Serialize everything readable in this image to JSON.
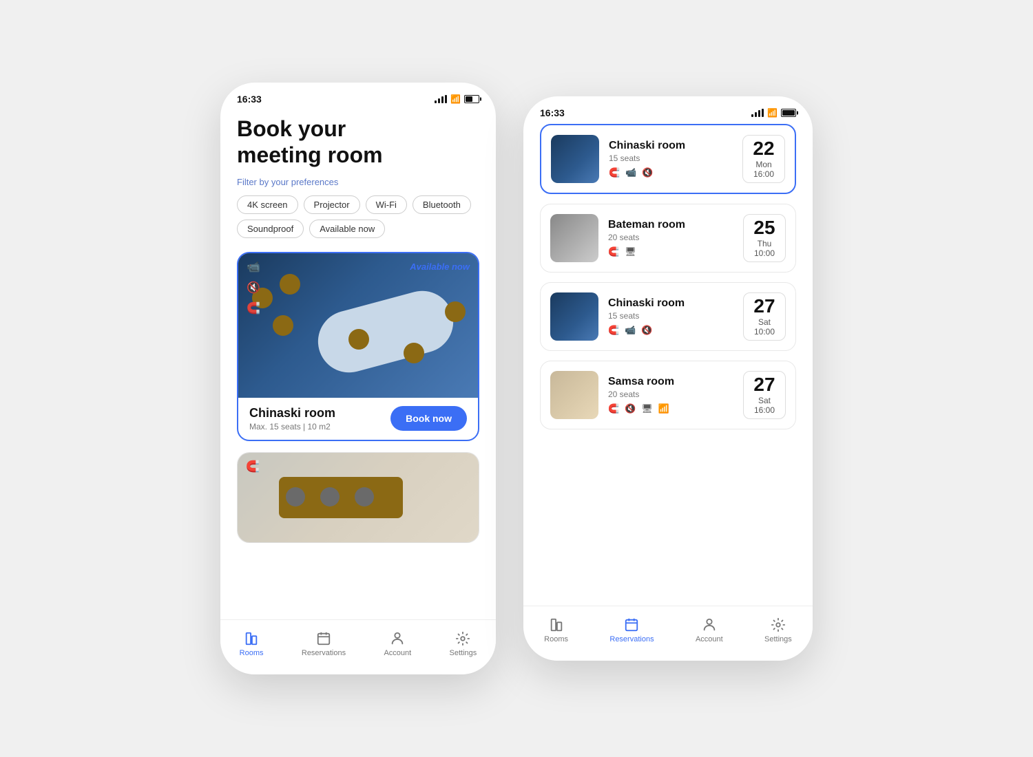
{
  "leftPhone": {
    "statusBar": {
      "time": "16:33"
    },
    "title": "Book your\nmeeting room",
    "filterLabel": "Filter by your preferences",
    "filters": [
      {
        "label": "4K screen",
        "active": false
      },
      {
        "label": "Projector",
        "active": false
      },
      {
        "label": "Wi-Fi",
        "active": false
      },
      {
        "label": "Bluetooth",
        "active": false
      },
      {
        "label": "Soundproof",
        "active": false
      },
      {
        "label": "Available now",
        "active": false
      }
    ],
    "featuredRoom": {
      "name": "Chinaski room",
      "seats": "Max. 15 seats",
      "size": "10 m2",
      "badge": "Available now",
      "bookLabel": "Book now"
    },
    "bottomNav": [
      {
        "label": "Rooms",
        "active": true
      },
      {
        "label": "Reservations",
        "active": false
      },
      {
        "label": "Account",
        "active": false
      },
      {
        "label": "Settings",
        "active": false
      }
    ]
  },
  "rightPhone": {
    "statusBar": {
      "time": "16:33"
    },
    "reservations": [
      {
        "name": "Chinaski room",
        "seats": "15 seats",
        "day": "22",
        "weekday": "Mon",
        "time": "16:00",
        "features": [
          "bluetooth",
          "camera",
          "mute"
        ],
        "highlighted": true,
        "thumb": "chinaski"
      },
      {
        "name": "Bateman room",
        "seats": "20 seats",
        "day": "25",
        "weekday": "Thu",
        "time": "10:00",
        "features": [
          "bluetooth",
          "monitor"
        ],
        "highlighted": false,
        "thumb": "bateman"
      },
      {
        "name": "Chinaski room",
        "seats": "15 seats",
        "day": "27",
        "weekday": "Sat",
        "time": "10:00",
        "features": [
          "bluetooth",
          "camera",
          "mute"
        ],
        "highlighted": false,
        "thumb": "chinaski"
      },
      {
        "name": "Samsa room",
        "seats": "20 seats",
        "day": "27",
        "weekday": "Sat",
        "time": "16:00",
        "features": [
          "bluetooth",
          "mute",
          "monitor",
          "wifi"
        ],
        "highlighted": false,
        "thumb": "samsa"
      }
    ],
    "bottomNav": [
      {
        "label": "Rooms",
        "active": false
      },
      {
        "label": "Reservations",
        "active": true
      },
      {
        "label": "Account",
        "active": false
      },
      {
        "label": "Settings",
        "active": false
      }
    ]
  }
}
